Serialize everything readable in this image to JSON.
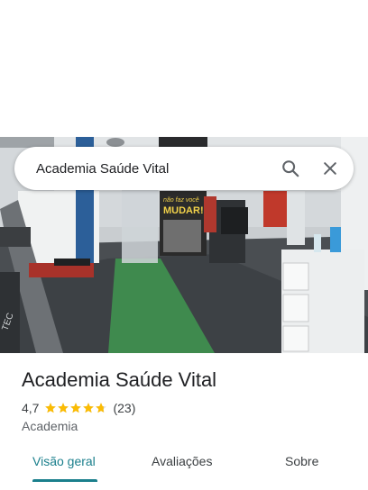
{
  "search": {
    "query": "Academia Saúde Vital"
  },
  "photo": {
    "poster_text_small": "não faz você",
    "poster_text_big": "MUDAR!",
    "machine_text": "TEC"
  },
  "place": {
    "name": "Academia Saúde Vital",
    "rating": "4,7",
    "stars": 4.7,
    "reviews": "(23)",
    "category": "Academia"
  },
  "tabs": [
    {
      "label": "Visão geral",
      "active": true
    },
    {
      "label": "Avaliações",
      "active": false
    },
    {
      "label": "Sobre",
      "active": false
    }
  ],
  "colors": {
    "accent": "#1a7f8c",
    "star": "#fbbc04"
  }
}
